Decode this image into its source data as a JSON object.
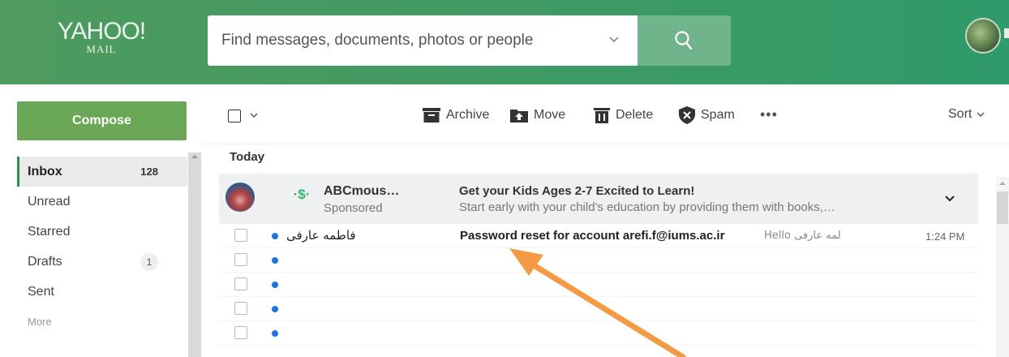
{
  "header": {
    "logo_brand": "YAHOO!",
    "logo_sub": "MAIL",
    "search_placeholder": "Find messages, documents, photos or people"
  },
  "sidebar": {
    "compose_label": "Compose",
    "items": [
      {
        "label": "Inbox",
        "count": "128"
      },
      {
        "label": "Unread"
      },
      {
        "label": "Starred"
      },
      {
        "label": "Drafts",
        "badge": "1"
      },
      {
        "label": "Sent"
      },
      {
        "label": "More"
      }
    ]
  },
  "toolbar": {
    "archive": "Archive",
    "move": "Move",
    "delete": "Delete",
    "spam": "Spam",
    "more": "•••",
    "sort": "Sort"
  },
  "list": {
    "section": "Today",
    "ad": {
      "icon": "·$·",
      "sender": "ABCmous…",
      "sponsored": "Sponsored",
      "subject": "Get your Kids Ages 2-7 Excited to Learn!",
      "preview": "Start early with your child's education by providing them with books,…"
    },
    "messages": [
      {
        "sender": "فاطمه عارفی",
        "subject": "Password reset for account arefi.f@iums.ac.ir",
        "preview": "Hello لمه عارفی",
        "time": "1:24 PM"
      },
      {
        "sender": "",
        "subject": "",
        "preview": "",
        "time": ""
      },
      {
        "sender": "",
        "subject": "",
        "preview": "",
        "time": ""
      },
      {
        "sender": "",
        "subject": "",
        "preview": "",
        "time": ""
      },
      {
        "sender": "",
        "subject": "",
        "preview": "",
        "time": ""
      }
    ]
  },
  "colors": {
    "header_green": "#3d9a64",
    "compose_green": "#6aa857",
    "search_button": "#6fb48b",
    "unread_dot": "#1a73e8",
    "annotation_arrow": "#f39a45"
  }
}
